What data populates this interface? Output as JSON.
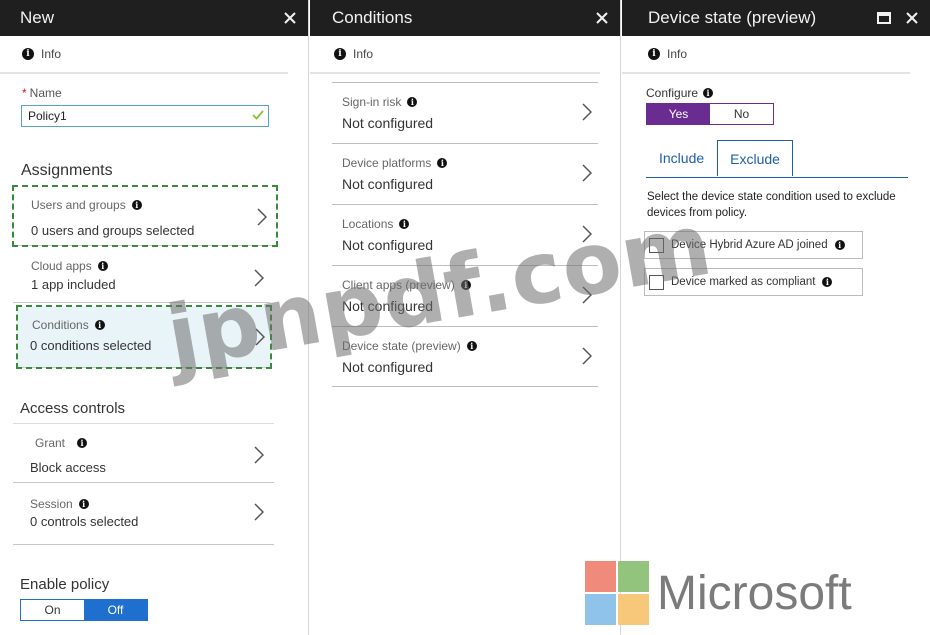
{
  "blade_new": {
    "title": "New",
    "info_label": "Info",
    "name_label": "Name",
    "name_value": "Policy1",
    "assignments_title": "Assignments",
    "cards": [
      {
        "label": "Users and groups",
        "value": "0 users and groups selected"
      },
      {
        "label": "Cloud apps",
        "value": "1 app included"
      },
      {
        "label": "Conditions",
        "value": "0  conditions  selected"
      }
    ],
    "access_title": "Access controls",
    "access_cards": [
      {
        "label": "Grant",
        "value": "Block access"
      },
      {
        "label": "Session",
        "value": "0 controls selected"
      }
    ],
    "enable_title": "Enable policy",
    "toggle_on": "On",
    "toggle_off": "Off"
  },
  "blade_conditions": {
    "title": "Conditions",
    "info_label": "Info",
    "items": [
      {
        "label": "Sign-in risk",
        "value": "Not configured"
      },
      {
        "label": "Device platforms",
        "value": "Not configured"
      },
      {
        "label": "Locations",
        "value": "Not configured"
      },
      {
        "label": "Client apps (preview)",
        "value": "Not configured"
      },
      {
        "label": "Device state (preview)",
        "value": "Not configured"
      }
    ]
  },
  "blade_device_state": {
    "title": "Device state (preview)",
    "info_label": "Info",
    "configure_label": "Configure",
    "yes": "Yes",
    "no": "No",
    "tab_include": "Include",
    "tab_exclude": "Exclude",
    "description": "Select the device state condition used to exclude devices from policy.",
    "options": [
      {
        "label": "Device Hybrid Azure AD joined",
        "checked": false
      },
      {
        "label": "Device marked as compliant",
        "checked": false
      }
    ]
  },
  "watermark": "jpnpdf.com",
  "logo_text": "Microsoft",
  "colors": {
    "header_bg": "#1f1f1f",
    "yes_purple": "#6a2c91",
    "toggle_blue": "#1f6fcf",
    "tab_blue": "#1f5fa8",
    "dashed_green": "#3a8a3a",
    "ms_red": "#f25022",
    "ms_green": "#7fba00",
    "ms_blue": "#00a4ef",
    "ms_yellow": "#ffb900"
  },
  "icons": [
    "close-icon",
    "maximize-icon",
    "info-icon",
    "checkmark-icon",
    "chevron-right-icon"
  ]
}
